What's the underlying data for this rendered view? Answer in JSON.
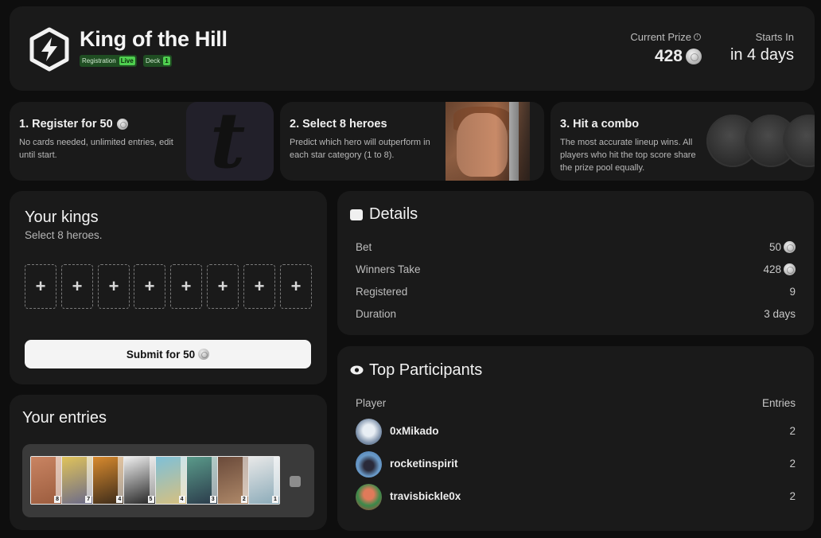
{
  "header": {
    "title": "King of the Hill",
    "badges": [
      {
        "label": "Registration",
        "value": "Live"
      },
      {
        "label": "Deck",
        "value": "1"
      }
    ],
    "current_prize_label": "Current Prize",
    "current_prize_value": "428",
    "starts_in_label": "Starts In",
    "starts_in_value": "in 4 days"
  },
  "steps": [
    {
      "title": "1. Register for 50",
      "text": "No cards needed, unlimited entries, edit until start."
    },
    {
      "title": "2. Select 8 heroes",
      "text": "Predict which hero will outperform in each star category (1 to 8)."
    },
    {
      "title": "3. Hit a combo",
      "text": "The most accurate lineup wins. All players who hit the top score share the prize pool equally."
    }
  ],
  "kings": {
    "title": "Your kings",
    "subtitle": "Select 8 heroes.",
    "slot_symbol": "+",
    "submit_label": "Submit for 50"
  },
  "entries": {
    "title": "Your entries",
    "card_numbers": [
      "8",
      "7",
      "4",
      "5",
      "4",
      "3",
      "2",
      "1"
    ]
  },
  "details": {
    "title": "Details",
    "rows": [
      {
        "label": "Bet",
        "value": "50"
      },
      {
        "label": "Winners Take",
        "value": "428"
      },
      {
        "label": "Registered",
        "value": "9"
      },
      {
        "label": "Duration",
        "value": "3 days"
      }
    ]
  },
  "participants": {
    "title": "Top Participants",
    "col_player": "Player",
    "col_entries": "Entries",
    "rows": [
      {
        "name": "0xMikado",
        "entries": "2"
      },
      {
        "name": "rocketinspirit",
        "entries": "2"
      },
      {
        "name": "travisbickle0x",
        "entries": "2"
      }
    ]
  },
  "colors": {
    "background": "#0e0e0e",
    "panel": "#1a1a1a",
    "live_green": "#4fcf4f"
  }
}
